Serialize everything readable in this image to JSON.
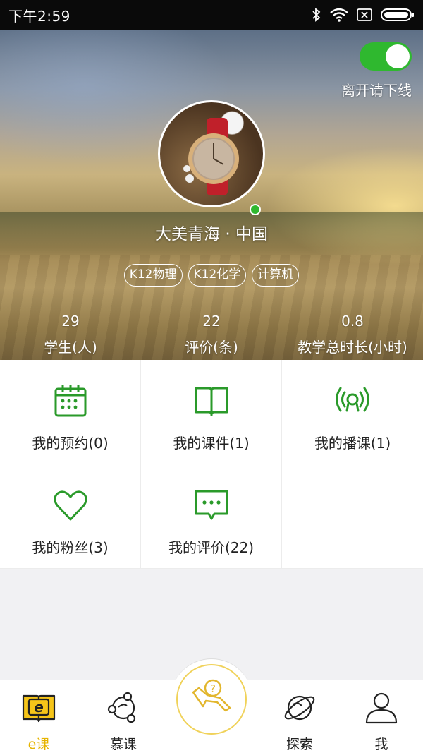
{
  "status_bar": {
    "time": "下午2:59",
    "icons": [
      "bluetooth-icon",
      "wifi-icon",
      "sim-icon",
      "battery-icon"
    ]
  },
  "profile": {
    "offline_toggle": {
      "on": true,
      "label": "离开请下线"
    },
    "name": "大美青海 · 中国",
    "online": true,
    "tags": [
      "K12物理",
      "K12化学",
      "计算机"
    ],
    "stats": [
      {
        "value": "29",
        "label": "学生(人)"
      },
      {
        "value": "22",
        "label": "评价(条)"
      },
      {
        "value": "0.8",
        "label": "教学总时长(小时)"
      }
    ]
  },
  "menu": [
    {
      "label": "我的预约(0)",
      "icon": "calendar-icon"
    },
    {
      "label": "我的课件(1)",
      "icon": "book-icon"
    },
    {
      "label": "我的播课(1)",
      "icon": "broadcast-icon"
    },
    {
      "label": "我的粉丝(3)",
      "icon": "heart-icon"
    },
    {
      "label": "我的评价(22)",
      "icon": "comment-icon"
    }
  ],
  "tabbar": {
    "tabs": [
      {
        "label": "e课",
        "icon": "ecourse-icon",
        "active": true
      },
      {
        "label": "慕课",
        "icon": "mooc-icon",
        "active": false
      },
      {
        "label": "探索",
        "icon": "planet-icon",
        "active": false
      },
      {
        "label": "我",
        "icon": "user-icon",
        "active": false
      }
    ],
    "center_icon": "ask-question-icon"
  },
  "colors": {
    "accent_green": "#2fb82f",
    "icon_green": "#2a9a2a",
    "active_tab": "#e6b400"
  }
}
